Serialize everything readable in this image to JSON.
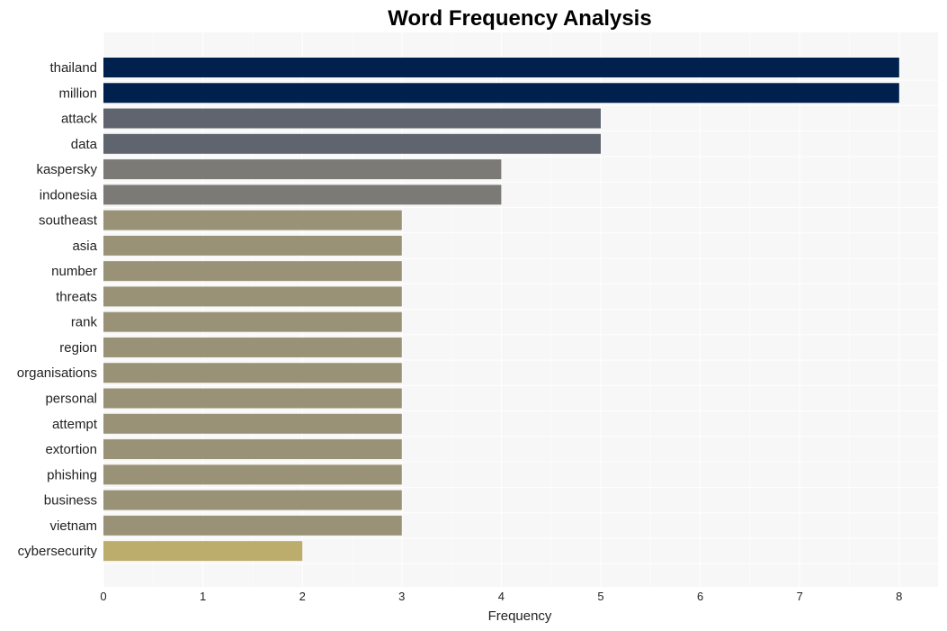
{
  "chart_data": {
    "type": "bar",
    "orientation": "horizontal",
    "title": "Word Frequency Analysis",
    "xlabel": "Frequency",
    "ylabel": "",
    "xlim": [
      0,
      8.4
    ],
    "xticks": [
      0,
      1,
      2,
      3,
      4,
      5,
      6,
      7,
      8
    ],
    "grid": true,
    "categories": [
      "thailand",
      "million",
      "attack",
      "data",
      "kaspersky",
      "indonesia",
      "southeast",
      "asia",
      "number",
      "threats",
      "rank",
      "region",
      "organisations",
      "personal",
      "attempt",
      "extortion",
      "phishing",
      "business",
      "vietnam",
      "cybersecurity"
    ],
    "values": [
      8,
      8,
      5,
      5,
      4,
      4,
      3,
      3,
      3,
      3,
      3,
      3,
      3,
      3,
      3,
      3,
      3,
      3,
      3,
      2
    ],
    "colors": {
      "8": "#00214d",
      "5": "#60646e",
      "4": "#7b7a77",
      "3": "#9a9276",
      "2": "#bcad6d"
    },
    "plot_background": "#f7f7f7",
    "gridline_color": "#ffffff"
  }
}
